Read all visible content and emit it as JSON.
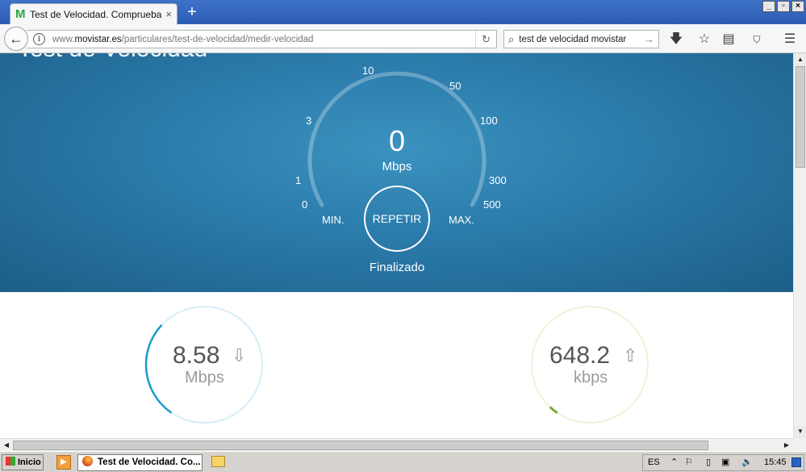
{
  "browser": {
    "tab_title": "Test de Velocidad. Comprueba l",
    "tab_close": "×",
    "new_tab": "+",
    "window_controls": [
      "_",
      "▫",
      "×"
    ],
    "url_prefix": "www.",
    "url_domain": "movistar.es",
    "url_path": "/particulares/test-de-velocidad/medir-velocidad",
    "search_value": "test de velocidad movistar",
    "toolbar_icons": [
      "download-icon",
      "bookmark-star-icon",
      "reading-list-icon",
      "ublock-icon",
      "menu-icon"
    ]
  },
  "hero": {
    "title": "Test de Velocidad",
    "ticks": [
      "0",
      "1",
      "3",
      "10",
      "50",
      "100",
      "300",
      "500"
    ],
    "speed_value": "0",
    "speed_unit": "Mbps",
    "repeat_label": "REPETIR",
    "min_label": "MIN.",
    "max_label": "MAX.",
    "status": "Finalizado"
  },
  "results": {
    "download": {
      "value": "8.58",
      "unit": "Mbps",
      "arrow": "⇩",
      "gauge_fraction": 0.27,
      "color": "#1a9ec8"
    },
    "upload": {
      "value": "648.2",
      "unit": "kbps",
      "arrow": "⇧",
      "gauge_fraction": 0.02,
      "color": "#7aa82a"
    }
  },
  "taskbar": {
    "start_label": "Inicio",
    "window_button": "Test de Velocidad. Co...",
    "language": "ES",
    "clock": "15:45"
  },
  "colors": {
    "hero_blue": "#2a7aaa",
    "tab_strip": "#3e72c8"
  }
}
